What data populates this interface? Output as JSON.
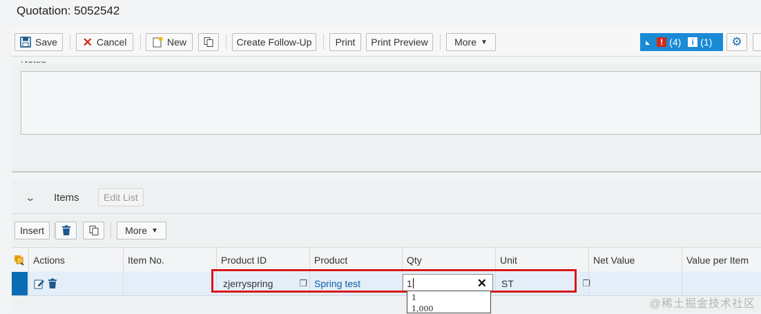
{
  "header": {
    "title": "Quotation: 5052542"
  },
  "toolbar": {
    "save": "Save",
    "cancel": "Cancel",
    "new": "New",
    "create_follow_up": "Create Follow-Up",
    "print": "Print",
    "print_preview": "Print Preview",
    "more": "More",
    "error_count": "(4)",
    "info_count": "(1)"
  },
  "notes": {
    "label": "Notes"
  },
  "items": {
    "title": "Items",
    "edit_list": "Edit List",
    "insert": "Insert",
    "more": "More",
    "columns": [
      "Actions",
      "Item No.",
      "Product ID",
      "Product",
      "Qty",
      "Unit",
      "Net Value",
      "Value per Item"
    ],
    "row": {
      "item_no": "",
      "product_id": "zjerryspring",
      "product": "Spring test",
      "qty": "1",
      "unit": "ST"
    },
    "qty_suggestions": [
      "1",
      "1,000"
    ]
  },
  "watermark": "@稀土掘金技术社区",
  "colors": {
    "accent": "#1a8ad6",
    "highlight": "#d7171a",
    "selected_row_marker": "#0a6cb3"
  }
}
